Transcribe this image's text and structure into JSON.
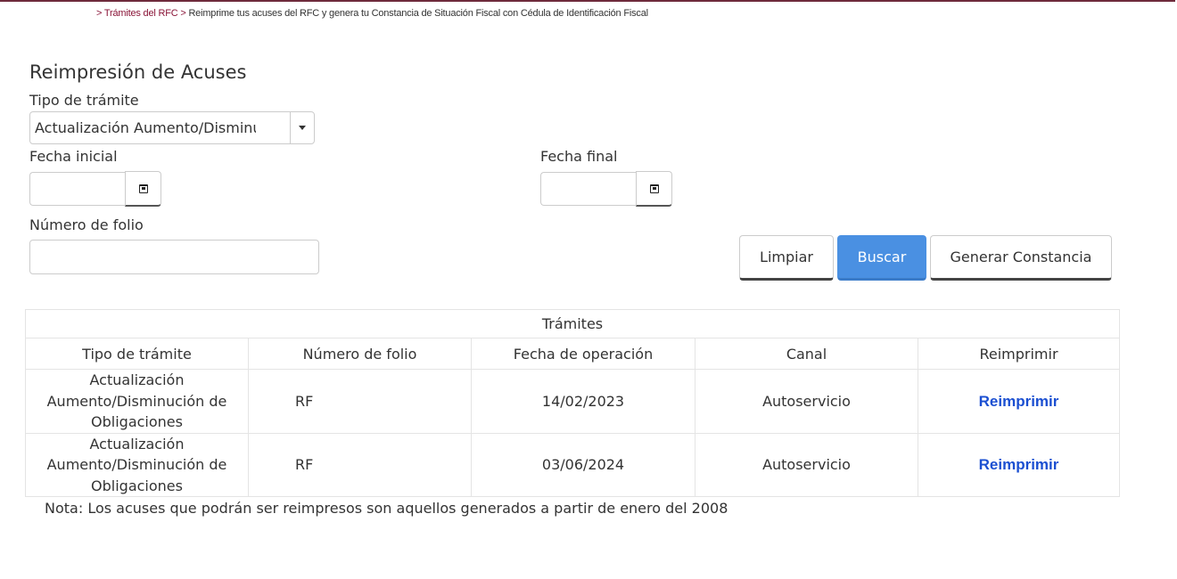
{
  "breadcrumb": {
    "link": "Trámites del RFC",
    "current": "Reimprime tus acuses del RFC y genera tu Constancia de Situación Fiscal con Cédula de Identificación Fiscal",
    "separator": ">"
  },
  "page_title": "Reimpresión de Acuses",
  "form": {
    "tipo_label": "Tipo de trámite",
    "tipo_selected": "Actualización Aumento/Disminución de Obligaciones",
    "fecha_inicial_label": "Fecha inicial",
    "fecha_inicial_value": "",
    "fecha_final_label": "Fecha final",
    "fecha_final_value": "",
    "folio_label": "Número de folio",
    "folio_value": ""
  },
  "buttons": {
    "limpiar": "Limpiar",
    "buscar": "Buscar",
    "generar": "Generar Constancia"
  },
  "table": {
    "caption": "Trámites",
    "headers": [
      "Tipo de trámite",
      "Número de folio",
      "Fecha de operación",
      "Canal",
      "Reimprimir"
    ],
    "rows": [
      {
        "tipo": "Actualización Aumento/Disminución de Obligaciones",
        "folio": "RF",
        "fecha": "14/02/2023",
        "canal": "Autoservicio",
        "accion": "Reimprimir"
      },
      {
        "tipo": "Actualización Aumento/Disminución de Obligaciones",
        "folio": "RF",
        "fecha": "03/06/2024",
        "canal": "Autoservicio",
        "accion": "Reimprimir"
      }
    ]
  },
  "note": "Nota: Los acuses que podrán ser reimpresos son aquellos generados a partir de enero del 2008",
  "colors": {
    "primary_button": "#4a90e2",
    "link": "#1b4fd1",
    "brand": "#8a1538"
  }
}
